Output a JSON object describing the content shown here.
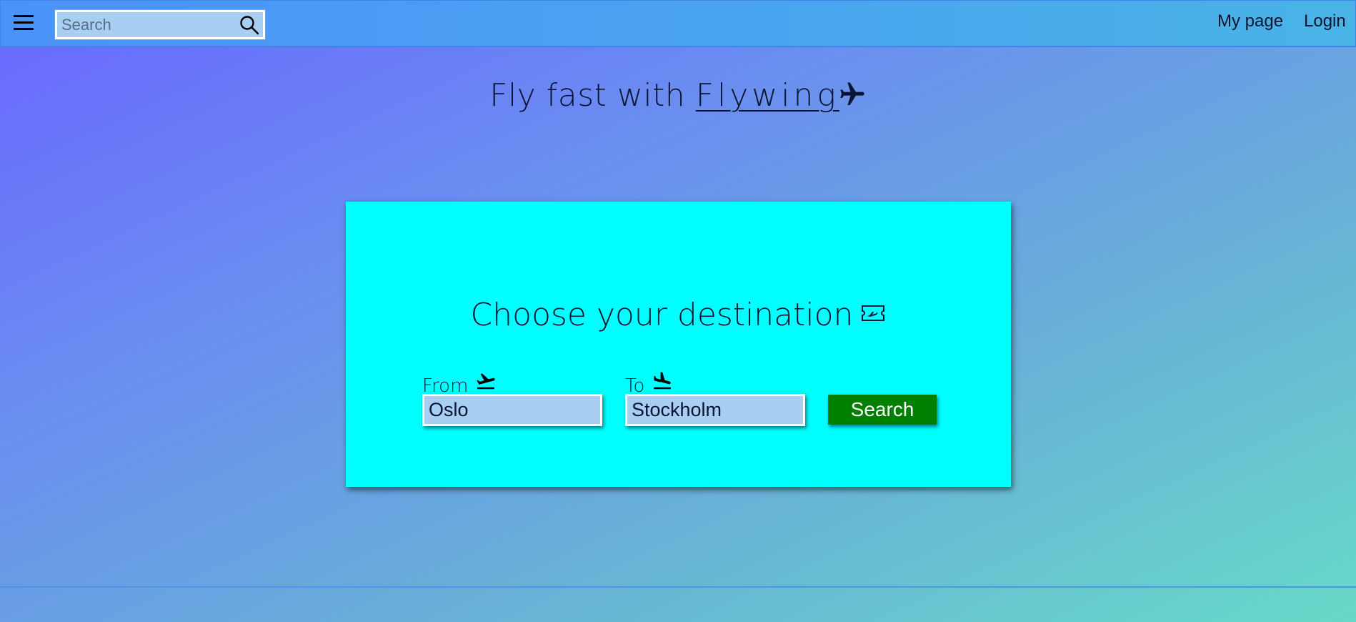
{
  "header": {
    "search_placeholder": "Search",
    "nav": {
      "my_page": "My page",
      "login": "Login"
    },
    "icons": {
      "menu": "hamburger-icon",
      "search": "magnifier-icon"
    }
  },
  "hero": {
    "prefix": "Fly fast with ",
    "brand": "Flywing",
    "icon": "airplane-icon"
  },
  "booking": {
    "title": "Choose your destination",
    "title_icon": "ticket-icon",
    "from": {
      "label": "From",
      "icon": "takeoff-icon",
      "value": "Oslo"
    },
    "to": {
      "label": "To",
      "icon": "landing-icon",
      "value": "Stockholm"
    },
    "search_button": "Search"
  },
  "colors": {
    "card_background": "#00ffff",
    "search_button": "#008000",
    "input_background": "#a8cff2",
    "topbar": "#4a9ff3"
  }
}
